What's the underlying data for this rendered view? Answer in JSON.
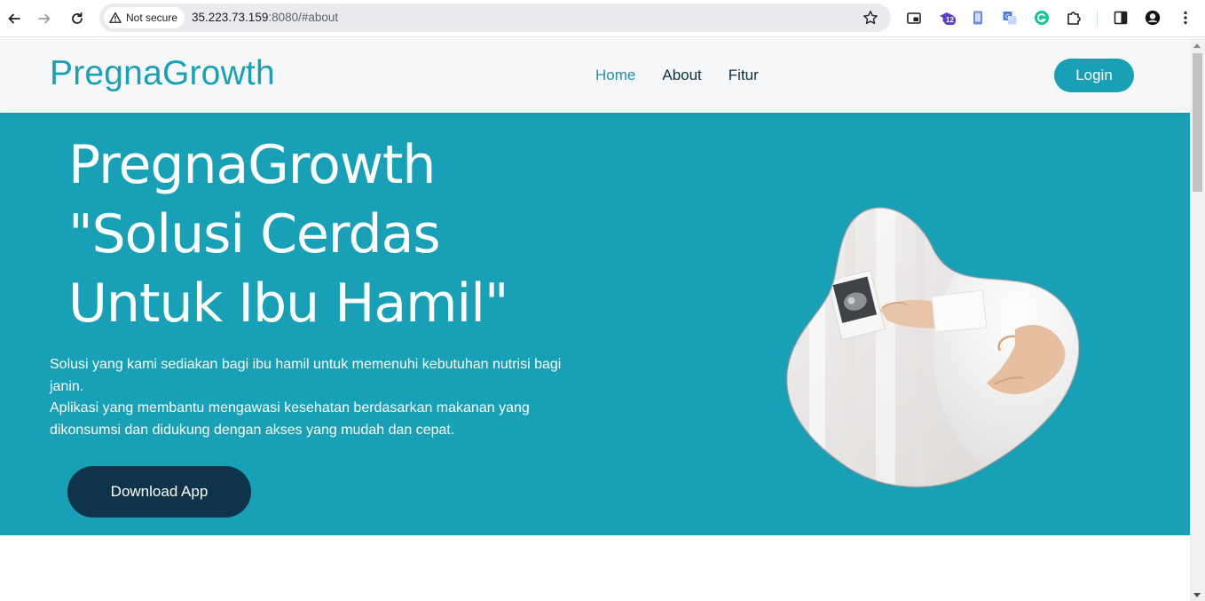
{
  "browser": {
    "security_label": "Not secure",
    "url_host": "35.223.73.159",
    "url_rest": ":8080/#about",
    "extension_badge": "12"
  },
  "site": {
    "brand": "PregnaGrowth",
    "nav": [
      {
        "label": "Home",
        "active": true
      },
      {
        "label": "About",
        "active": false
      },
      {
        "label": "Fitur",
        "active": false
      }
    ],
    "login_label": "Login"
  },
  "hero": {
    "title_lines": [
      "PregnaGrowth",
      "\"Solusi Cerdas",
      "Untuk Ibu Hamil\""
    ],
    "description_1": "Solusi yang kami sediakan bagi ibu hamil untuk memenuhi kebutuhan nutrisi bagi janin.",
    "description_2": "Aplikasi yang membantu mengawasi kesehatan berdasarkan makanan yang dikonsumsi dan didukung dengan akses yang mudah dan cepat.",
    "download_label": "Download App",
    "image_subject": "pregnant-woman-holding-ultrasound-photo",
    "colors": {
      "accent": "#17a0b6",
      "dark_button": "#0e344b",
      "header_bg": "#f6f8fa"
    }
  }
}
